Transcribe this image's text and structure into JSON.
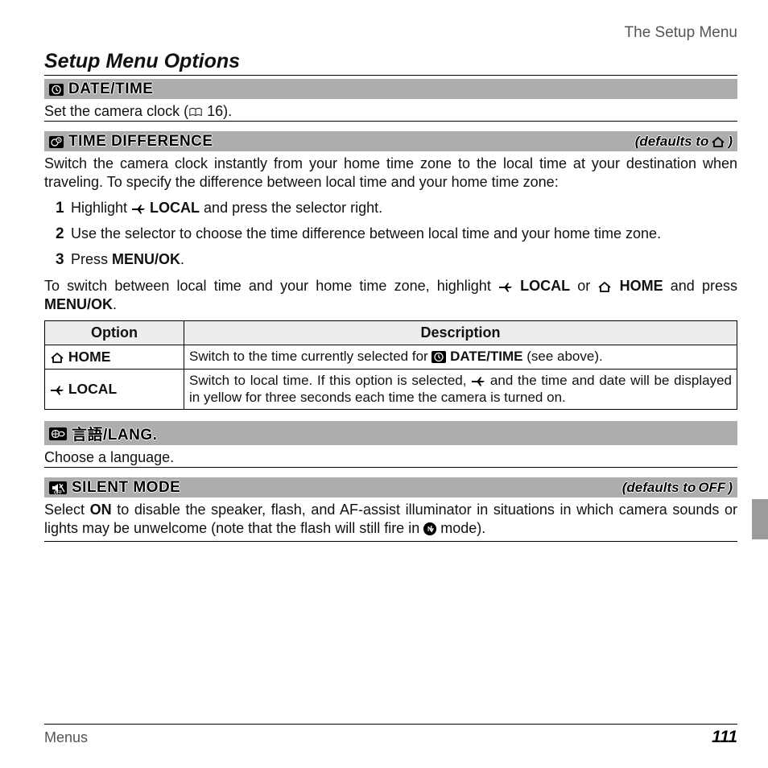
{
  "running_head": "The Setup Menu",
  "section_title": "Setup Menu Options",
  "date_time": {
    "heading": "DATE/TIME",
    "body_pre": "Set the camera clock (",
    "body_ref": " 16).",
    "icon": "clock-icon"
  },
  "time_diff": {
    "heading": "TIME DIFFERENCE",
    "default_pre": "(defaults to ",
    "default_post": ")",
    "body": "Switch the camera clock instantly from your home time zone to the local time at your destination when traveling.  To specify the difference between local time and your home time zone:",
    "steps": [
      {
        "n": "1",
        "pre": "Highlight ",
        "mid": " LOCAL",
        "post": " and press the selector right."
      },
      {
        "n": "2",
        "text": "Use the selector to choose the time difference between local time and your home time zone."
      },
      {
        "n": "3",
        "pre": "Press ",
        "bold": "MENU/OK",
        "post": "."
      }
    ],
    "switch_pre": "To switch between local time and your home time zone, highlight ",
    "switch_local": " LOCAL",
    "switch_or": " or ",
    "switch_home": " HOME",
    "switch_post": " and press ",
    "switch_bold": "MENU/OK",
    "switch_end": "."
  },
  "table": {
    "headers": [
      "Option",
      "Description"
    ],
    "rows": [
      {
        "icon": "home",
        "option": " HOME",
        "desc_pre": "Switch to the time currently selected for ",
        "desc_bold": " DATE/TIME",
        "desc_post": " (see above)."
      },
      {
        "icon": "plane",
        "option": " LOCAL",
        "desc_pre": "Switch to local time.  If this option is selected, ",
        "desc_post": " and the time and date will be displayed in yellow for three seconds each time the camera is turned on."
      }
    ]
  },
  "lang": {
    "heading_jp": "言語",
    "heading_slash": "/",
    "heading_en": "LANG.",
    "body": "Choose a language."
  },
  "silent": {
    "heading": "SILENT MODE",
    "default_pre": "(defaults to ",
    "default_val": "OFF",
    "default_post": ")",
    "body_pre": "Select ",
    "body_on": "ON",
    "body_mid": " to disable the speaker, flash, and AF-assist illuminator in situations in which camera sounds or lights may be unwelcome (note that the flash will still fire in ",
    "body_post": " mode)."
  },
  "footer_left": "Menus",
  "footer_page": "111"
}
